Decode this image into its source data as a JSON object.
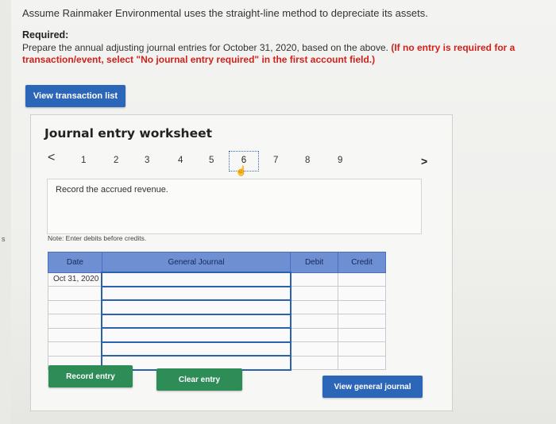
{
  "intro": "Assume Rainmaker Environmental uses the straight-line method to depreciate its assets.",
  "required": {
    "heading": "Required:",
    "text": "Prepare the annual adjusting journal entries for October 31, 2020, based on the above.",
    "emphasis": "(If no entry is required for a transaction/event, select \"No journal entry required\" in the first account field.)"
  },
  "buttons": {
    "view_transaction_list": "View transaction list",
    "record_entry": "Record entry",
    "clear_entry": "Clear entry",
    "view_general_journal": "View general journal"
  },
  "worksheet": {
    "title": "Journal entry worksheet",
    "prev_icon": "chevron-left-icon",
    "next_icon": "chevron-right-icon",
    "prev_glyph": "<",
    "next_glyph": ">",
    "steps": [
      "1",
      "2",
      "3",
      "4",
      "5",
      "6",
      "7",
      "8",
      "9"
    ],
    "current_step": "6",
    "description": "Record the accrued revenue.",
    "note": "Note: Enter debits before credits."
  },
  "table": {
    "headers": {
      "date": "Date",
      "account": "General Journal",
      "debit": "Debit",
      "credit": "Credit"
    },
    "first_date": "Oct 31, 2020"
  },
  "side_mark": "s",
  "colors": {
    "primary_blue": "#2b66b8",
    "green": "#2e8c56",
    "red_emphasis": "#d0211c",
    "table_header": "#6f8fd3"
  }
}
